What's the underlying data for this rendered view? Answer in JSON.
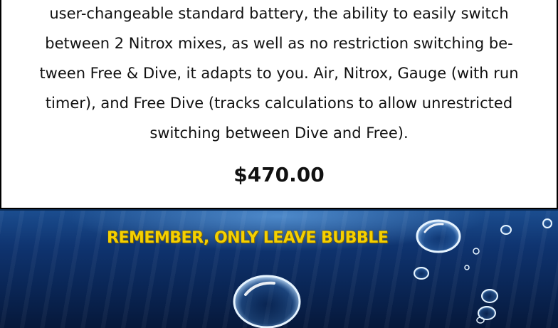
{
  "description": {
    "lines": [
      "user-changeable standard battery, the ability to easily switch",
      "between 2 Nitrox mixes, as well as no restriction switching be-",
      "tween Free & Dive, it adapts to you. Air, Nitrox, Gauge (with run",
      "timer), and Free Dive (tracks calculations to allow unrestricted",
      "switching between Dive and Free)."
    ]
  },
  "price": "$470.00",
  "banner": {
    "slogan": "REMEMBER, ONLY LEAVE BUBBLE"
  }
}
